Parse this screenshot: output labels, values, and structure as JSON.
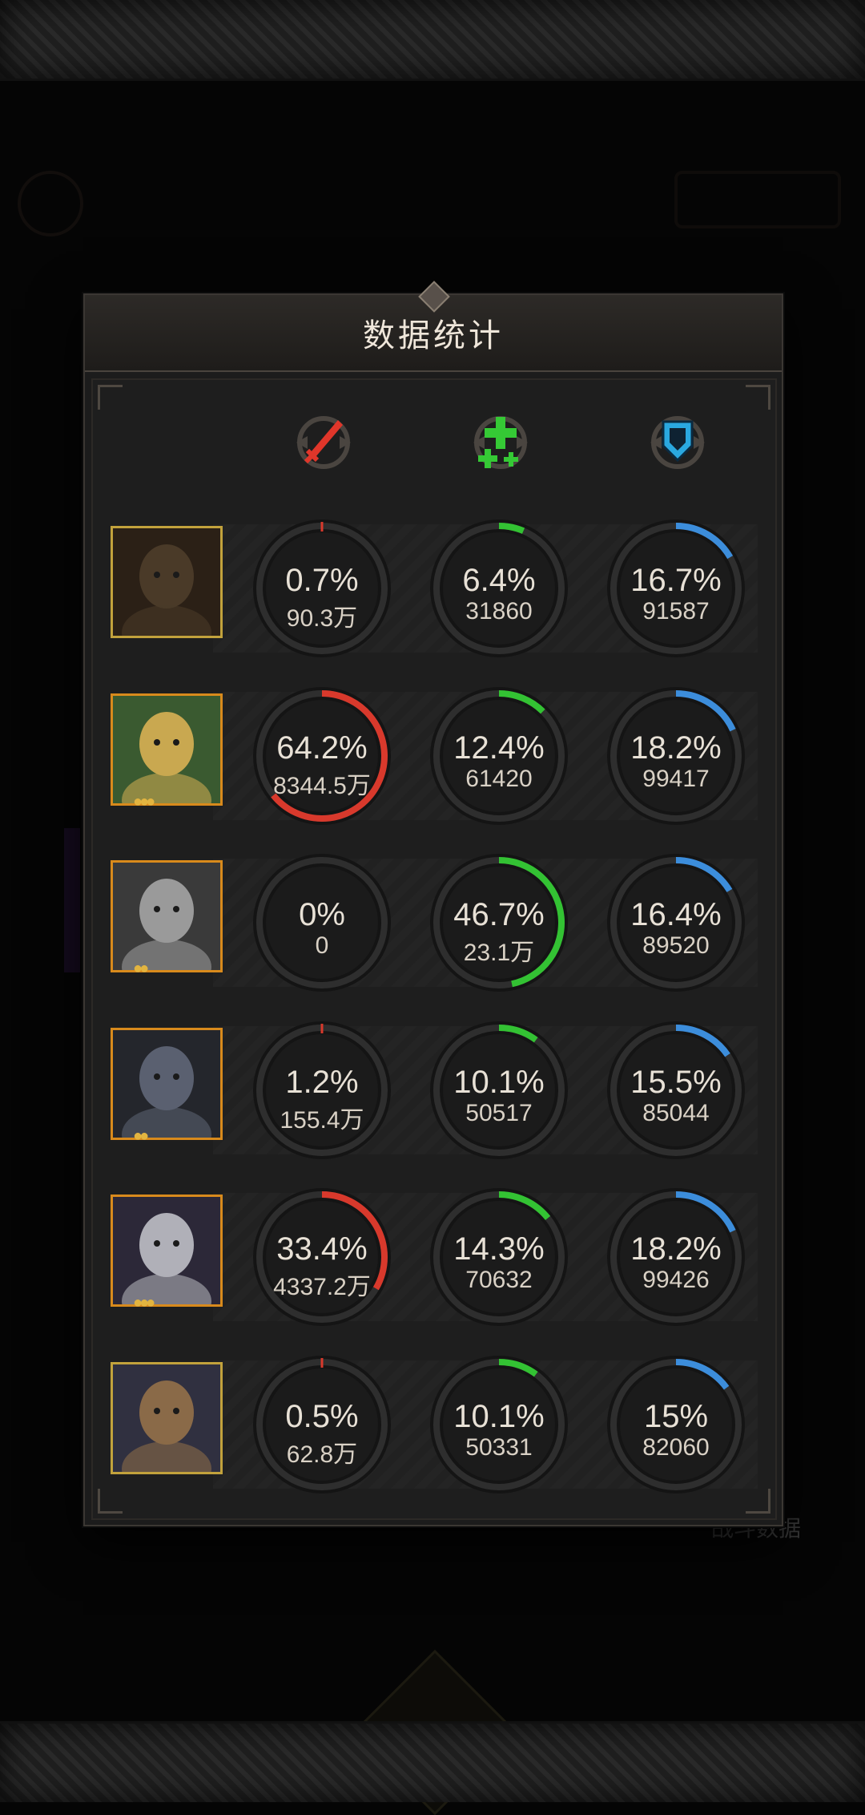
{
  "dialog": {
    "title": "数据统计"
  },
  "columns": [
    {
      "icon": "sword-icon",
      "color": "#d8392c"
    },
    {
      "icon": "heal-cross-icon",
      "color": "#33c233"
    },
    {
      "icon": "shield-icon",
      "color": "#3c8ddb"
    }
  ],
  "background": {
    "side_text": "战斗数据"
  },
  "rows": [
    {
      "hero": "hero-bearded-warrior",
      "frame": "gold-plain",
      "stars": "",
      "damage": {
        "pct": "0.7%",
        "val": "90.3万",
        "frac": 0.007
      },
      "heal": {
        "pct": "6.4%",
        "val": "31860",
        "frac": 0.064
      },
      "tank": {
        "pct": "16.7%",
        "val": "91587",
        "frac": 0.167
      }
    },
    {
      "hero": "hero-blonde-mage",
      "frame": "flame",
      "stars": "●●●",
      "damage": {
        "pct": "64.2%",
        "val": "8344.5万",
        "frac": 0.642
      },
      "heal": {
        "pct": "12.4%",
        "val": "61420",
        "frac": 0.124
      },
      "tank": {
        "pct": "18.2%",
        "val": "99417",
        "frac": 0.182
      }
    },
    {
      "hero": "hero-silver-priestess",
      "frame": "flame",
      "stars": "●●",
      "damage": {
        "pct": "0%",
        "val": "0",
        "frac": 0.0
      },
      "heal": {
        "pct": "46.7%",
        "val": "23.1万",
        "frac": 0.467
      },
      "tank": {
        "pct": "16.4%",
        "val": "89520",
        "frac": 0.164
      }
    },
    {
      "hero": "hero-werewolf",
      "frame": "flame",
      "stars": "●●",
      "damage": {
        "pct": "1.2%",
        "val": "155.4万",
        "frac": 0.012
      },
      "heal": {
        "pct": "10.1%",
        "val": "50517",
        "frac": 0.101
      },
      "tank": {
        "pct": "15.5%",
        "val": "85044",
        "frac": 0.155
      }
    },
    {
      "hero": "hero-dark-elf",
      "frame": "flame",
      "stars": "●●●",
      "damage": {
        "pct": "33.4%",
        "val": "4337.2万",
        "frac": 0.334
      },
      "heal": {
        "pct": "14.3%",
        "val": "70632",
        "frac": 0.143
      },
      "tank": {
        "pct": "18.2%",
        "val": "99426",
        "frac": 0.182
      }
    },
    {
      "hero": "hero-horned-rogue",
      "frame": "gold-plain",
      "stars": "",
      "damage": {
        "pct": "0.5%",
        "val": "62.8万",
        "frac": 0.005
      },
      "heal": {
        "pct": "10.1%",
        "val": "50331",
        "frac": 0.101
      },
      "tank": {
        "pct": "15%",
        "val": "82060",
        "frac": 0.15
      }
    }
  ]
}
